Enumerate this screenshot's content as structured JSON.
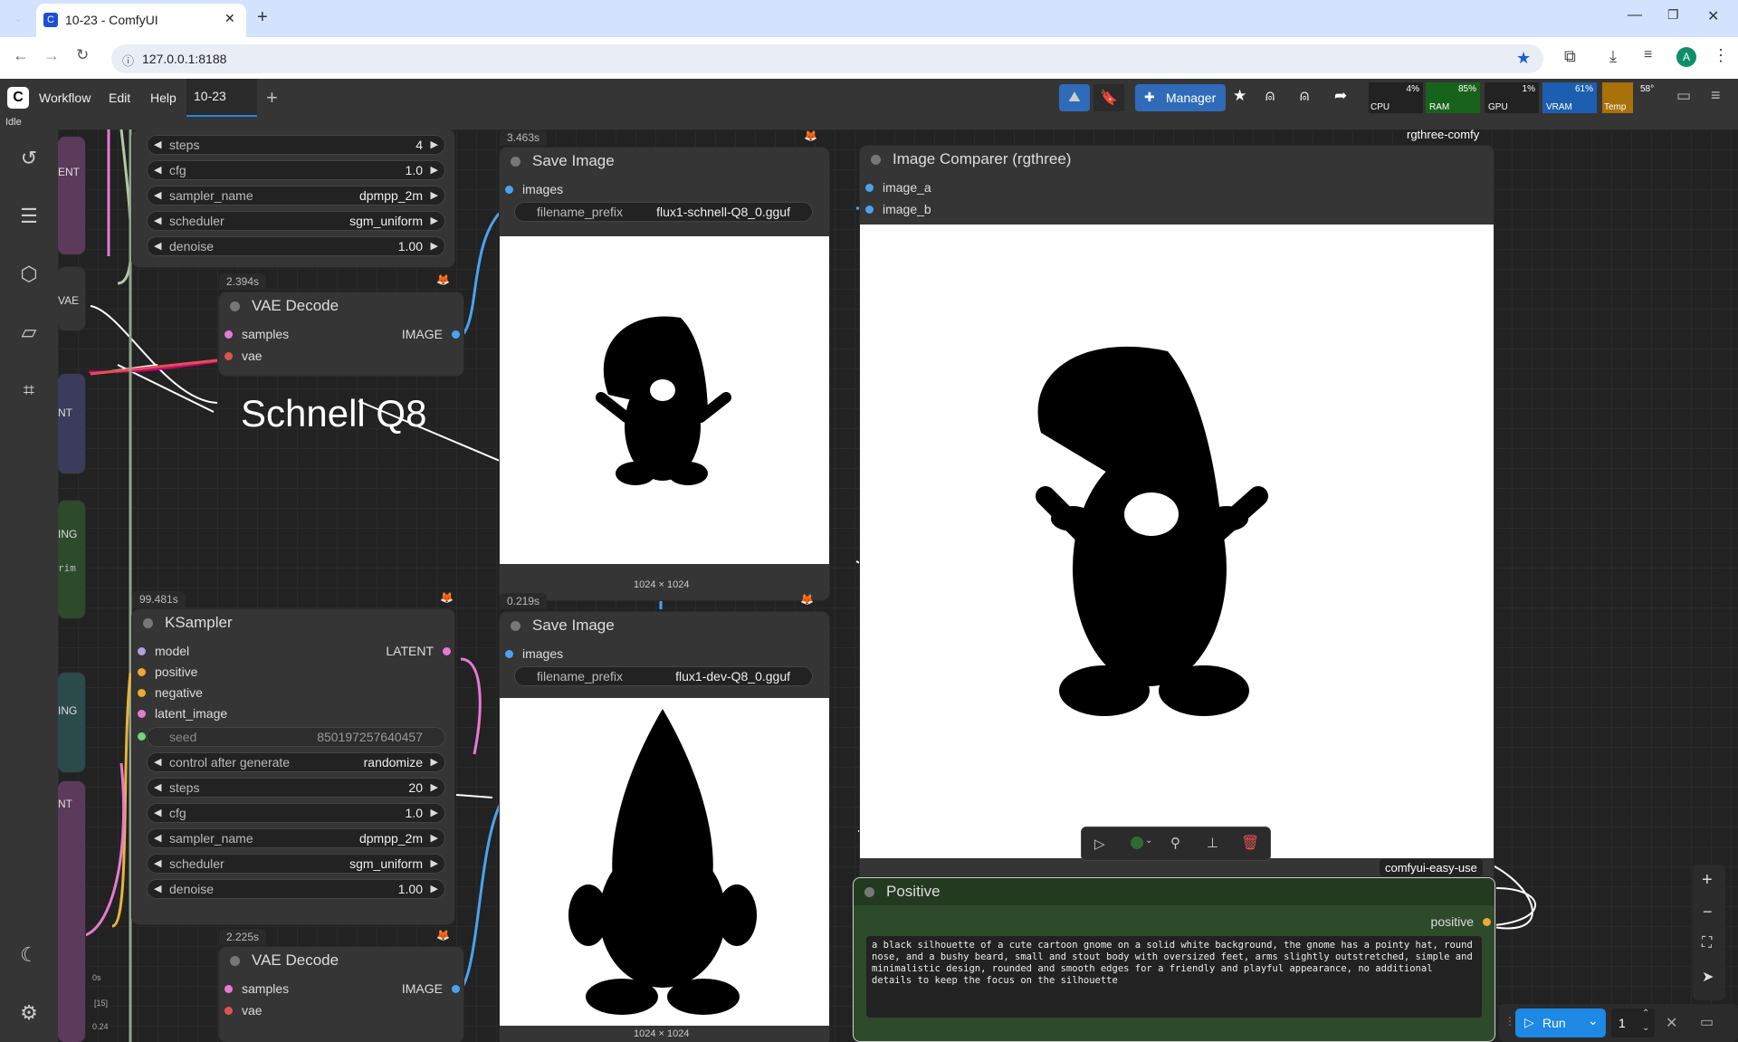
{
  "browser": {
    "tab_title": "10-23 - ComfyUI",
    "url": "127.0.0.1:8188"
  },
  "menubar": {
    "items": [
      "Workflow",
      "Edit",
      "Help"
    ],
    "workflow_tab": "10-23",
    "manager_label": "Manager"
  },
  "monitor": {
    "cpu_pct": "4%",
    "cpu": "CPU",
    "ram_pct": "85%",
    "ram": "RAM",
    "gpu_pct": "1%",
    "gpu": "GPU",
    "vram_pct": "61%",
    "vram": "VRAM",
    "temp_val": "58°",
    "temp": "Temp"
  },
  "status": "Idle",
  "group_label": "Schnell Q8",
  "ksampler_top": {
    "steps": {
      "label": "steps",
      "value": "4"
    },
    "cfg": {
      "label": "cfg",
      "value": "1.0"
    },
    "sampler_name": {
      "label": "sampler_name",
      "value": "dpmpp_2m"
    },
    "scheduler": {
      "label": "scheduler",
      "value": "sgm_uniform"
    },
    "denoise": {
      "label": "denoise",
      "value": "1.00"
    }
  },
  "vae_decode_top": {
    "time": "2.394s",
    "title": "VAE Decode",
    "in1": "samples",
    "in2": "vae",
    "out": "IMAGE"
  },
  "save_image_top": {
    "time": "3.463s",
    "title": "Save Image",
    "in": "images",
    "prefix_label": "filename_prefix",
    "prefix_value": "flux1-schnell-Q8_0.gguf",
    "size": "1024 × 1024"
  },
  "save_image_bottom": {
    "time": "0.219s",
    "title": "Save Image",
    "in": "images",
    "prefix_label": "filename_prefix",
    "prefix_value": "flux1-dev-Q8_0.gguf",
    "size": "1024 × 1024"
  },
  "comparer": {
    "title": "Image Comparer (rgthree)",
    "badge": "rgthree-comfy",
    "in1": "image_a",
    "in2": "image_b"
  },
  "ksampler": {
    "time": "99.481s",
    "title": "KSampler",
    "in": [
      "model",
      "positive",
      "negative",
      "latent_image"
    ],
    "out": "LATENT",
    "seed_label": "seed",
    "seed_value": "850197257640457",
    "control_label": "control after generate",
    "control_value": "randomize",
    "steps": {
      "label": "steps",
      "value": "20"
    },
    "cfg": {
      "label": "cfg",
      "value": "1.0"
    },
    "sampler_name": {
      "label": "sampler_name",
      "value": "dpmpp_2m"
    },
    "scheduler": {
      "label": "scheduler",
      "value": "sgm_uniform"
    },
    "denoise": {
      "label": "denoise",
      "value": "1.00"
    }
  },
  "vae_decode_bottom": {
    "time": "2.225s",
    "title": "VAE Decode",
    "in1": "samples",
    "in2": "vae",
    "out": "IMAGE"
  },
  "positive": {
    "title": "Positive",
    "badge": "comfyui-easy-use",
    "out": "positive",
    "text": "a black silhouette of a cute cartoon gnome on a solid white background, the gnome has a pointy hat, round nose, and a bushy beard, small and stout body with oversized feet, arms slightly outstretched, simple and minimalistic design, rounded and smooth edges for a friendly and playful appearance, no additional details to keep the focus on the silhouette"
  },
  "left_partial": {
    "l1": "ENT",
    "l2": "VAE",
    "l3": "NT",
    "l4": "ING",
    "l5": "rim",
    "l6": "ING",
    "l7": "NT",
    "l8": "0s",
    "l9": "[15]",
    "l10": "0.24"
  },
  "run": {
    "label": "Run",
    "count": "1"
  },
  "colors": {
    "accent": "#1e88e5",
    "node_bg": "#353535",
    "canvas": "#222222",
    "positive_bg": "#2d4a2b"
  }
}
